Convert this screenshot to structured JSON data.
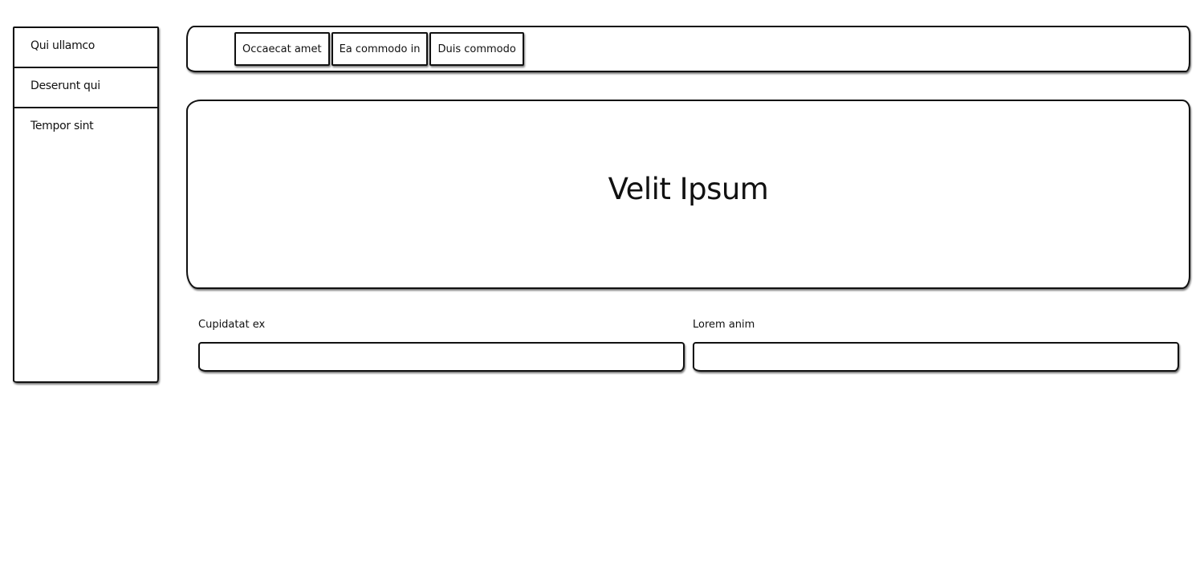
{
  "sidebar": {
    "items": [
      {
        "label": "Qui ullamco"
      },
      {
        "label": "Deserunt qui"
      },
      {
        "label": "Tempor sint"
      }
    ]
  },
  "tabs": [
    {
      "label": "Occaecat amet"
    },
    {
      "label": "Ea commodo in"
    },
    {
      "label": "Duis commodo"
    }
  ],
  "hero": {
    "title": "Velit Ipsum"
  },
  "form": {
    "fields": [
      {
        "label": "Cupidatat ex",
        "value": "",
        "placeholder": ""
      },
      {
        "label": "Lorem anim",
        "value": "",
        "placeholder": ""
      }
    ]
  }
}
